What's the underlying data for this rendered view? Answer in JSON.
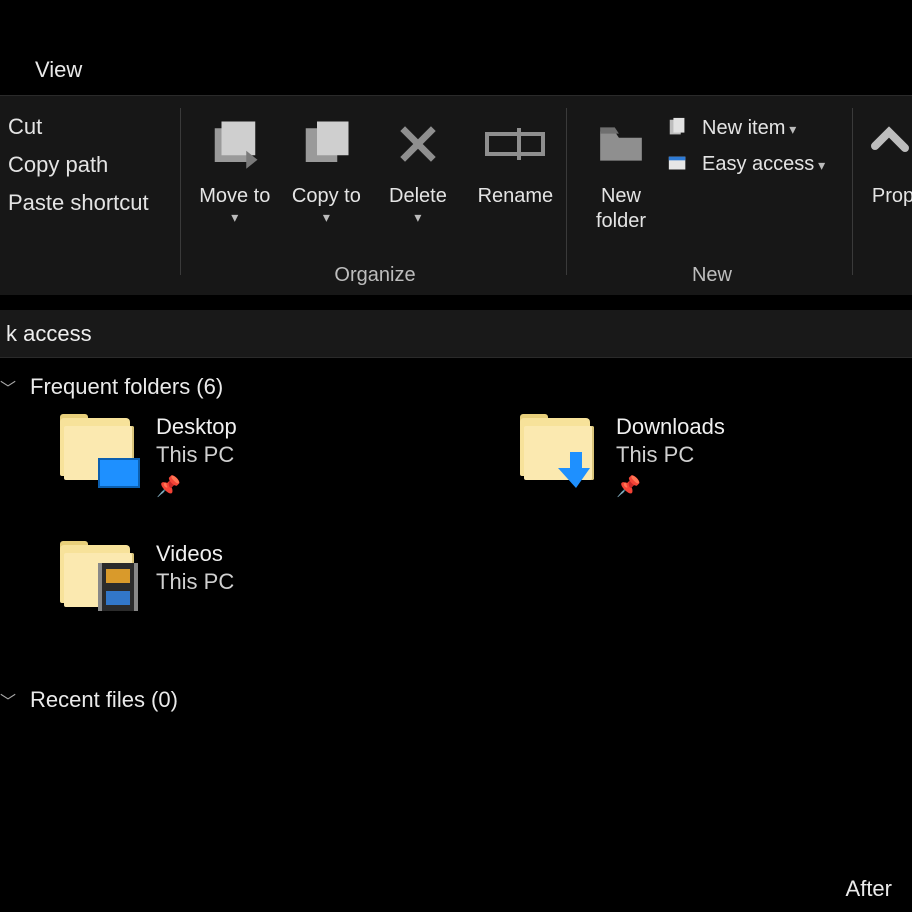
{
  "tabs": {
    "view": "View"
  },
  "ribbon": {
    "clipboard": {
      "cut": "Cut",
      "copy_path": "Copy path",
      "paste_shortcut": "Paste shortcut"
    },
    "organize": {
      "label": "Organize",
      "move_to": "Move to",
      "copy_to": "Copy to",
      "delete": "Delete",
      "rename": "Rename"
    },
    "new": {
      "label": "New",
      "new_folder": "New folder",
      "new_item": "New item",
      "easy_access": "Easy access"
    },
    "open": {
      "properties": "Prop"
    }
  },
  "address": {
    "location": "k access"
  },
  "sections": {
    "frequent": {
      "title": "Frequent folders (6)",
      "count": 6
    },
    "recent": {
      "title": "Recent files (0)",
      "count": 0
    }
  },
  "folders": [
    {
      "name": "Desktop",
      "location": "This PC",
      "pinned": true,
      "icon": "desktop"
    },
    {
      "name": "Downloads",
      "location": "This PC",
      "pinned": true,
      "icon": "downloads"
    },
    {
      "name": "Videos",
      "location": "This PC",
      "pinned": false,
      "icon": "videos"
    }
  ],
  "footer": {
    "hint": "After"
  },
  "glyphs": {
    "pin": "📌"
  }
}
